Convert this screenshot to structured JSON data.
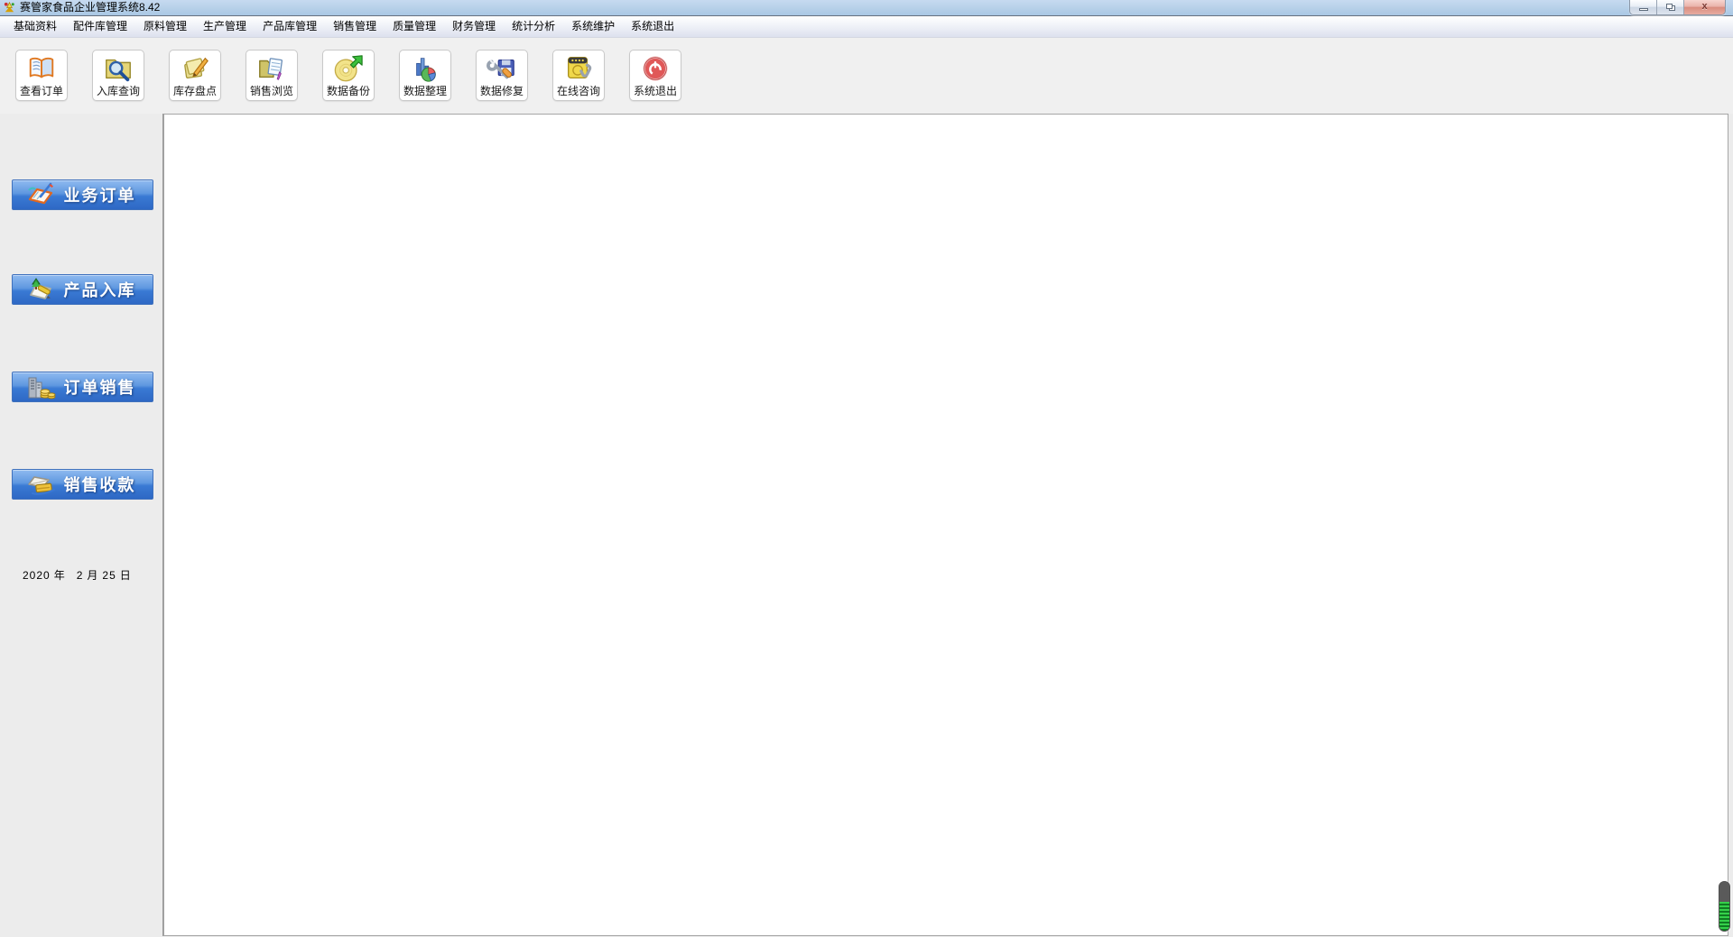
{
  "titlebar": {
    "title": "赛管家食品企业管理系统8.42",
    "controls": [
      "minimize-icon",
      "restore-icon",
      "close-icon"
    ],
    "close_glyph": "x"
  },
  "menubar": {
    "items": [
      "基础资料",
      "配件库管理",
      "原料管理",
      "生产管理",
      "产品库管理",
      "销售管理",
      "质量管理",
      "财务管理",
      "统计分析",
      "系统维护",
      "系统退出"
    ]
  },
  "toolbar": {
    "buttons": [
      {
        "label": "查看订单",
        "icon": "open-book-icon"
      },
      {
        "label": "入库查询",
        "icon": "folder-search-icon"
      },
      {
        "label": "库存盘点",
        "icon": "notes-pencil-icon"
      },
      {
        "label": "销售浏览",
        "icon": "folder-document-icon"
      },
      {
        "label": "数据备份",
        "icon": "cd-backup-icon"
      },
      {
        "label": "数据整理",
        "icon": "chart-pie-icon"
      },
      {
        "label": "数据修复",
        "icon": "wrench-floppy-icon"
      },
      {
        "label": "在线咨询",
        "icon": "online-phone-icon"
      },
      {
        "label": "系统退出",
        "icon": "power-icon"
      }
    ]
  },
  "sidebar": {
    "buttons": [
      {
        "label": "业务订单",
        "icon": "clipboard-pencil-icon"
      },
      {
        "label": "产品入库",
        "icon": "notepad-tree-icon"
      },
      {
        "label": "订单销售",
        "icon": "building-coins-icon"
      },
      {
        "label": "销售收款",
        "icon": "envelope-card-icon"
      }
    ],
    "date": {
      "year": "2020",
      "year_unit": "年",
      "month": "2",
      "month_unit": "月",
      "day": "25",
      "day_unit": "日"
    }
  },
  "colors": {
    "titlebar_blue": "#b5cfe8",
    "sidebar_button_blue": "#3a7ad4",
    "toolbar_bg": "#f0f0f0",
    "power_red": "#e05050",
    "indicator_green": "#35d04a"
  }
}
